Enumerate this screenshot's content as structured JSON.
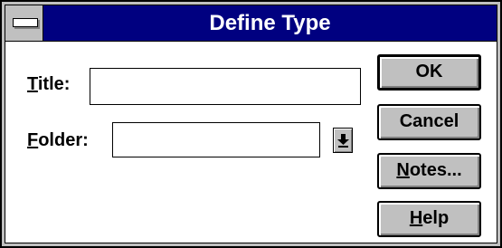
{
  "window": {
    "title": "Define Type"
  },
  "fields": {
    "title": {
      "label_accel": "T",
      "label_rest": "itle:",
      "value": ""
    },
    "folder": {
      "label_accel": "F",
      "label_rest": "older:",
      "value": ""
    }
  },
  "buttons": {
    "ok": {
      "label": "OK"
    },
    "cancel": {
      "label": "Cancel"
    },
    "notes": {
      "label_accel": "N",
      "label_rest": "otes..."
    },
    "help": {
      "label_accel": "H",
      "label_rest": "elp"
    }
  },
  "icons": {
    "system_menu": "system-menu-icon",
    "dropdown": "down-arrow-icon"
  },
  "colors": {
    "titlebar": "#000080",
    "title_text": "#ffffff",
    "button_face": "#c0c0c0",
    "background": "#ffffff"
  }
}
